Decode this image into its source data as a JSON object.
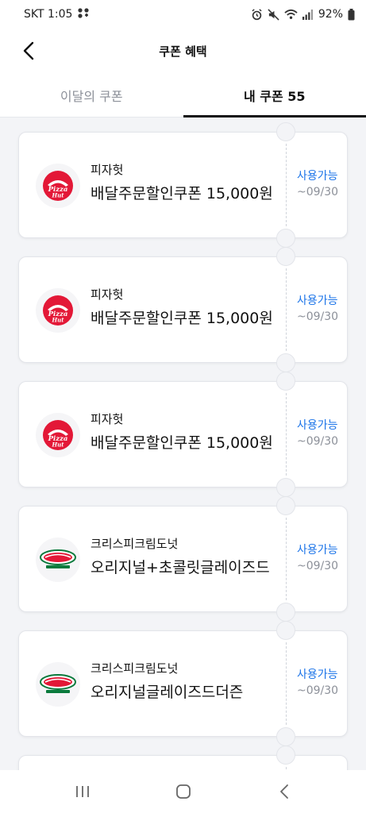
{
  "status_bar": {
    "carrier_time": "SKT 1:05",
    "battery": "92%",
    "icons": [
      "app-notification-icon",
      "alarm-icon",
      "mute-icon",
      "wifi-icon",
      "signal-icon",
      "battery-icon"
    ]
  },
  "header": {
    "back_icon": "chevron-left-icon",
    "title": "쿠폰 혜택"
  },
  "tabs": [
    {
      "label": "이달의 쿠폰",
      "active": false
    },
    {
      "label": "내 쿠폰 55",
      "active": true
    }
  ],
  "coupons": [
    {
      "brand": "피자헛",
      "logo": "pizza-hut-logo",
      "title": "배달주문할인쿠폰 15,000원",
      "status": "사용가능",
      "expiry": "~09/30"
    },
    {
      "brand": "피자헛",
      "logo": "pizza-hut-logo",
      "title": "배달주문할인쿠폰 15,000원",
      "status": "사용가능",
      "expiry": "~09/30"
    },
    {
      "brand": "피자헛",
      "logo": "pizza-hut-logo",
      "title": "배달주문할인쿠폰 15,000원",
      "status": "사용가능",
      "expiry": "~09/30"
    },
    {
      "brand": "크리스피크림도넛",
      "logo": "krispy-kreme-logo",
      "title": "오리지널+초콜릿글레이즈드",
      "status": "사용가능",
      "expiry": "~09/30"
    },
    {
      "brand": "크리스피크림도넛",
      "logo": "krispy-kreme-logo",
      "title": "오리지널글레이즈드더즌",
      "status": "사용가능",
      "expiry": "~09/30"
    }
  ],
  "nav_bar": {
    "icons": [
      "recent-apps-icon",
      "home-icon",
      "back-icon"
    ]
  },
  "colors": {
    "accent_blue": "#1a73e8",
    "pizza_hut_red": "#e31837",
    "krispy_green": "#0a7a3c",
    "list_background": "#f3f4f7"
  }
}
